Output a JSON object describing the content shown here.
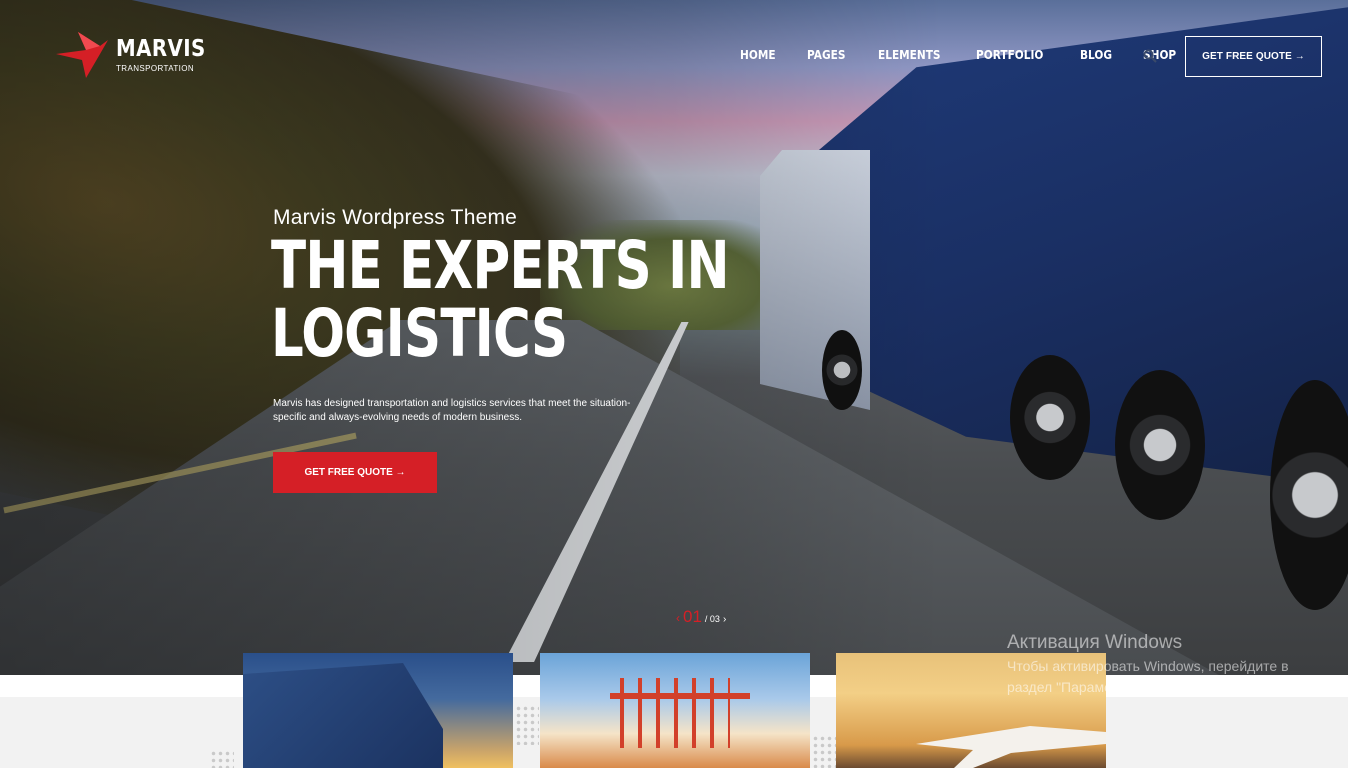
{
  "brand": {
    "name": "MARVIS",
    "tagline": "TRANSPORTATION",
    "accent_color": "#d51f26"
  },
  "nav": {
    "items": [
      {
        "label": "HOME"
      },
      {
        "label": "PAGES"
      },
      {
        "label": "ELEMENTS"
      },
      {
        "label": "PORTFOLIO"
      },
      {
        "label": "BLOG"
      },
      {
        "label": "SHOP"
      }
    ],
    "search_icon": "search-icon",
    "cta_label": "GET FREE QUOTE →"
  },
  "hero": {
    "kicker": "Marvis Wordpress Theme",
    "headline_line1": "THE EXPERTS IN",
    "headline_line2": "LOGISTICS",
    "description": "Marvis has designed transportation and logistics services that meet the situation-specific and always-evolving needs of modern business.",
    "cta_label": "GET FREE QUOTE →"
  },
  "slider": {
    "prev_arrow": "‹",
    "current": "01",
    "total": "/ 03",
    "next_arrow": "›"
  },
  "cards": [
    {
      "image": "truck-sunset-image"
    },
    {
      "image": "port-cranes-image"
    },
    {
      "image": "airplane-sunset-image"
    }
  ],
  "windows_watermark": {
    "title": "Активация Windows",
    "text": "Чтобы активировать Windows, перейдите в раздел \"Параметры\"."
  }
}
